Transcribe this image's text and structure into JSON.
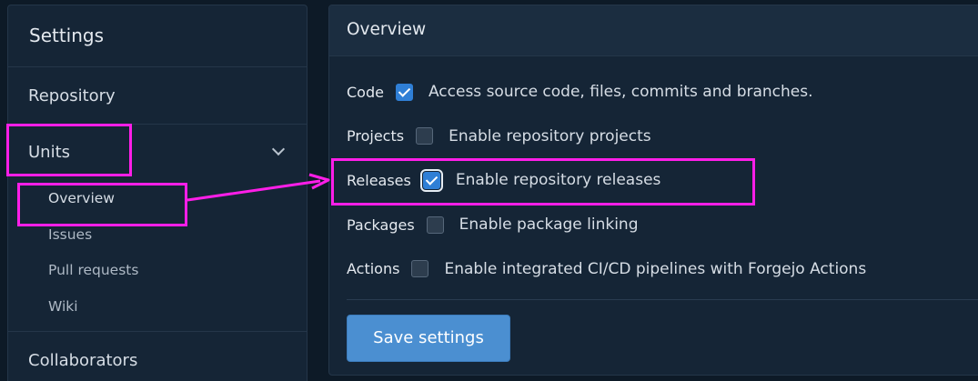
{
  "sidebar": {
    "title": "Settings",
    "repository": "Repository",
    "units": {
      "label": "Units",
      "sub_items": [
        "Overview",
        "Issues",
        "Pull requests",
        "Wiki"
      ]
    },
    "collaborators": "Collaborators"
  },
  "main": {
    "title": "Overview",
    "rows": [
      {
        "label": "Code",
        "checked": true,
        "description": "Access source code, files, commits and branches."
      },
      {
        "label": "Projects",
        "checked": false,
        "description": "Enable repository projects"
      },
      {
        "label": "Releases",
        "checked": true,
        "description": "Enable repository releases"
      },
      {
        "label": "Packages",
        "checked": false,
        "description": "Enable package linking"
      },
      {
        "label": "Actions",
        "checked": false,
        "description": "Enable integrated CI/CD pipelines with Forgejo Actions"
      }
    ],
    "save_label": "Save settings"
  },
  "colors": {
    "annotation": "#ff1ee8",
    "accent": "#2f7fd6",
    "button": "#4b8fd1"
  }
}
